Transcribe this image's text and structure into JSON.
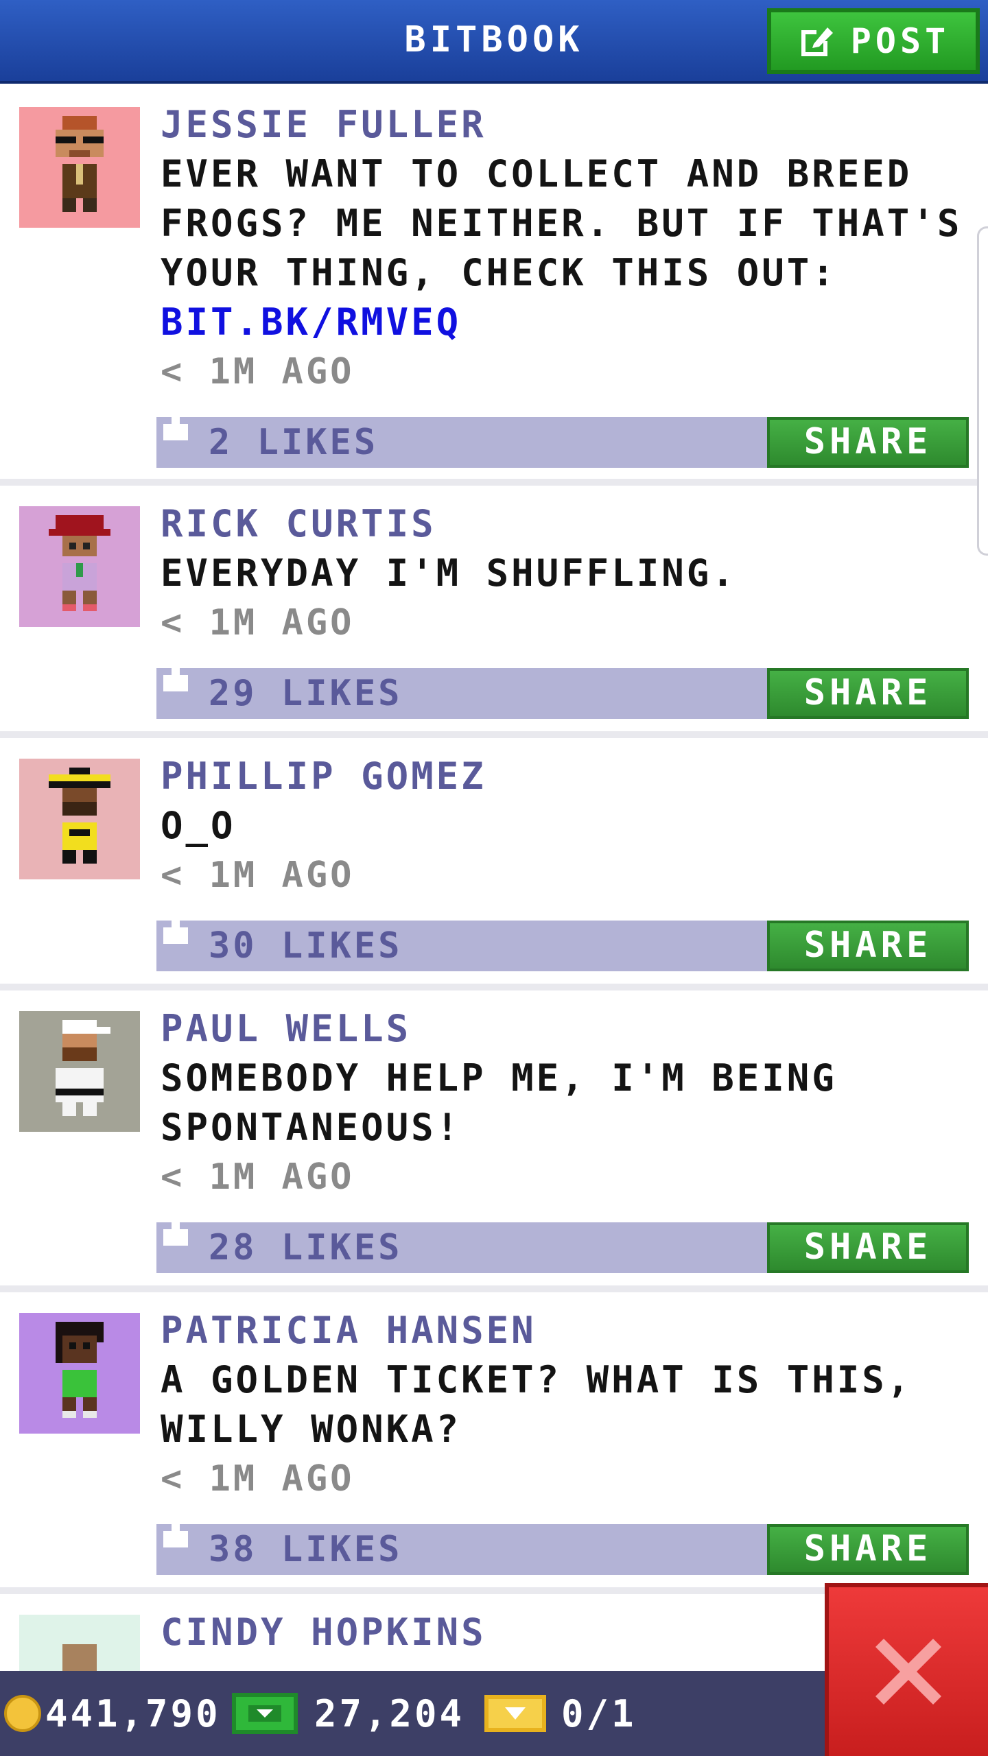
{
  "header": {
    "title": "BITBOOK",
    "post_label": "POST"
  },
  "posts": [
    {
      "author": "JESSIE FULLER",
      "message": "EVER WANT TO COLLECT AND BREED FROGS? ME NEITHER. BUT IF THAT'S YOUR THING, CHECK THIS OUT:",
      "link": "BIT.BK/RMVEQ",
      "time": "< 1M AGO",
      "likes": "2 LIKES",
      "share_label": "SHARE",
      "avatar_bg": "#f59aa0"
    },
    {
      "author": "RICK CURTIS",
      "message": "EVERYDAY I'M SHUFFLING.",
      "time": "< 1M AGO",
      "likes": "29 LIKES",
      "share_label": "SHARE",
      "avatar_bg": "#d6a1d6"
    },
    {
      "author": "PHILLIP GOMEZ",
      "message": "O_O",
      "time": "< 1M AGO",
      "likes": "30 LIKES",
      "share_label": "SHARE",
      "avatar_bg": "#e9b3b6"
    },
    {
      "author": "PAUL WELLS",
      "message": "SOMEBODY HELP ME, I'M BEING SPONTANEOUS!",
      "time": "< 1M AGO",
      "likes": "28 LIKES",
      "share_label": "SHARE",
      "avatar_bg": "#a3a396"
    },
    {
      "author": "PATRICIA HANSEN",
      "message": "A GOLDEN TICKET? WHAT IS THIS, WILLY WONKA?",
      "time": "< 1M AGO",
      "likes": "38 LIKES",
      "share_label": "SHARE",
      "avatar_bg": "#b98ae6"
    },
    {
      "author": "CINDY HOPKINS",
      "avatar_bg": "#dff3e9"
    }
  ],
  "status": {
    "coins": "441,790",
    "bux": "27,204",
    "tickets": "0/1"
  },
  "colors": {
    "header_blue": "#2a56b8",
    "post_green": "#36b236",
    "bar_lavender": "#b3b3d6",
    "author_purple": "#5a5a9a",
    "close_red": "#e02a2a"
  },
  "icons": {
    "post": "edit-icon",
    "like": "thumbs-up-icon",
    "coin": "coin-icon",
    "bux": "bux-icon",
    "ticket": "golden-ticket-icon",
    "close": "close-icon"
  }
}
